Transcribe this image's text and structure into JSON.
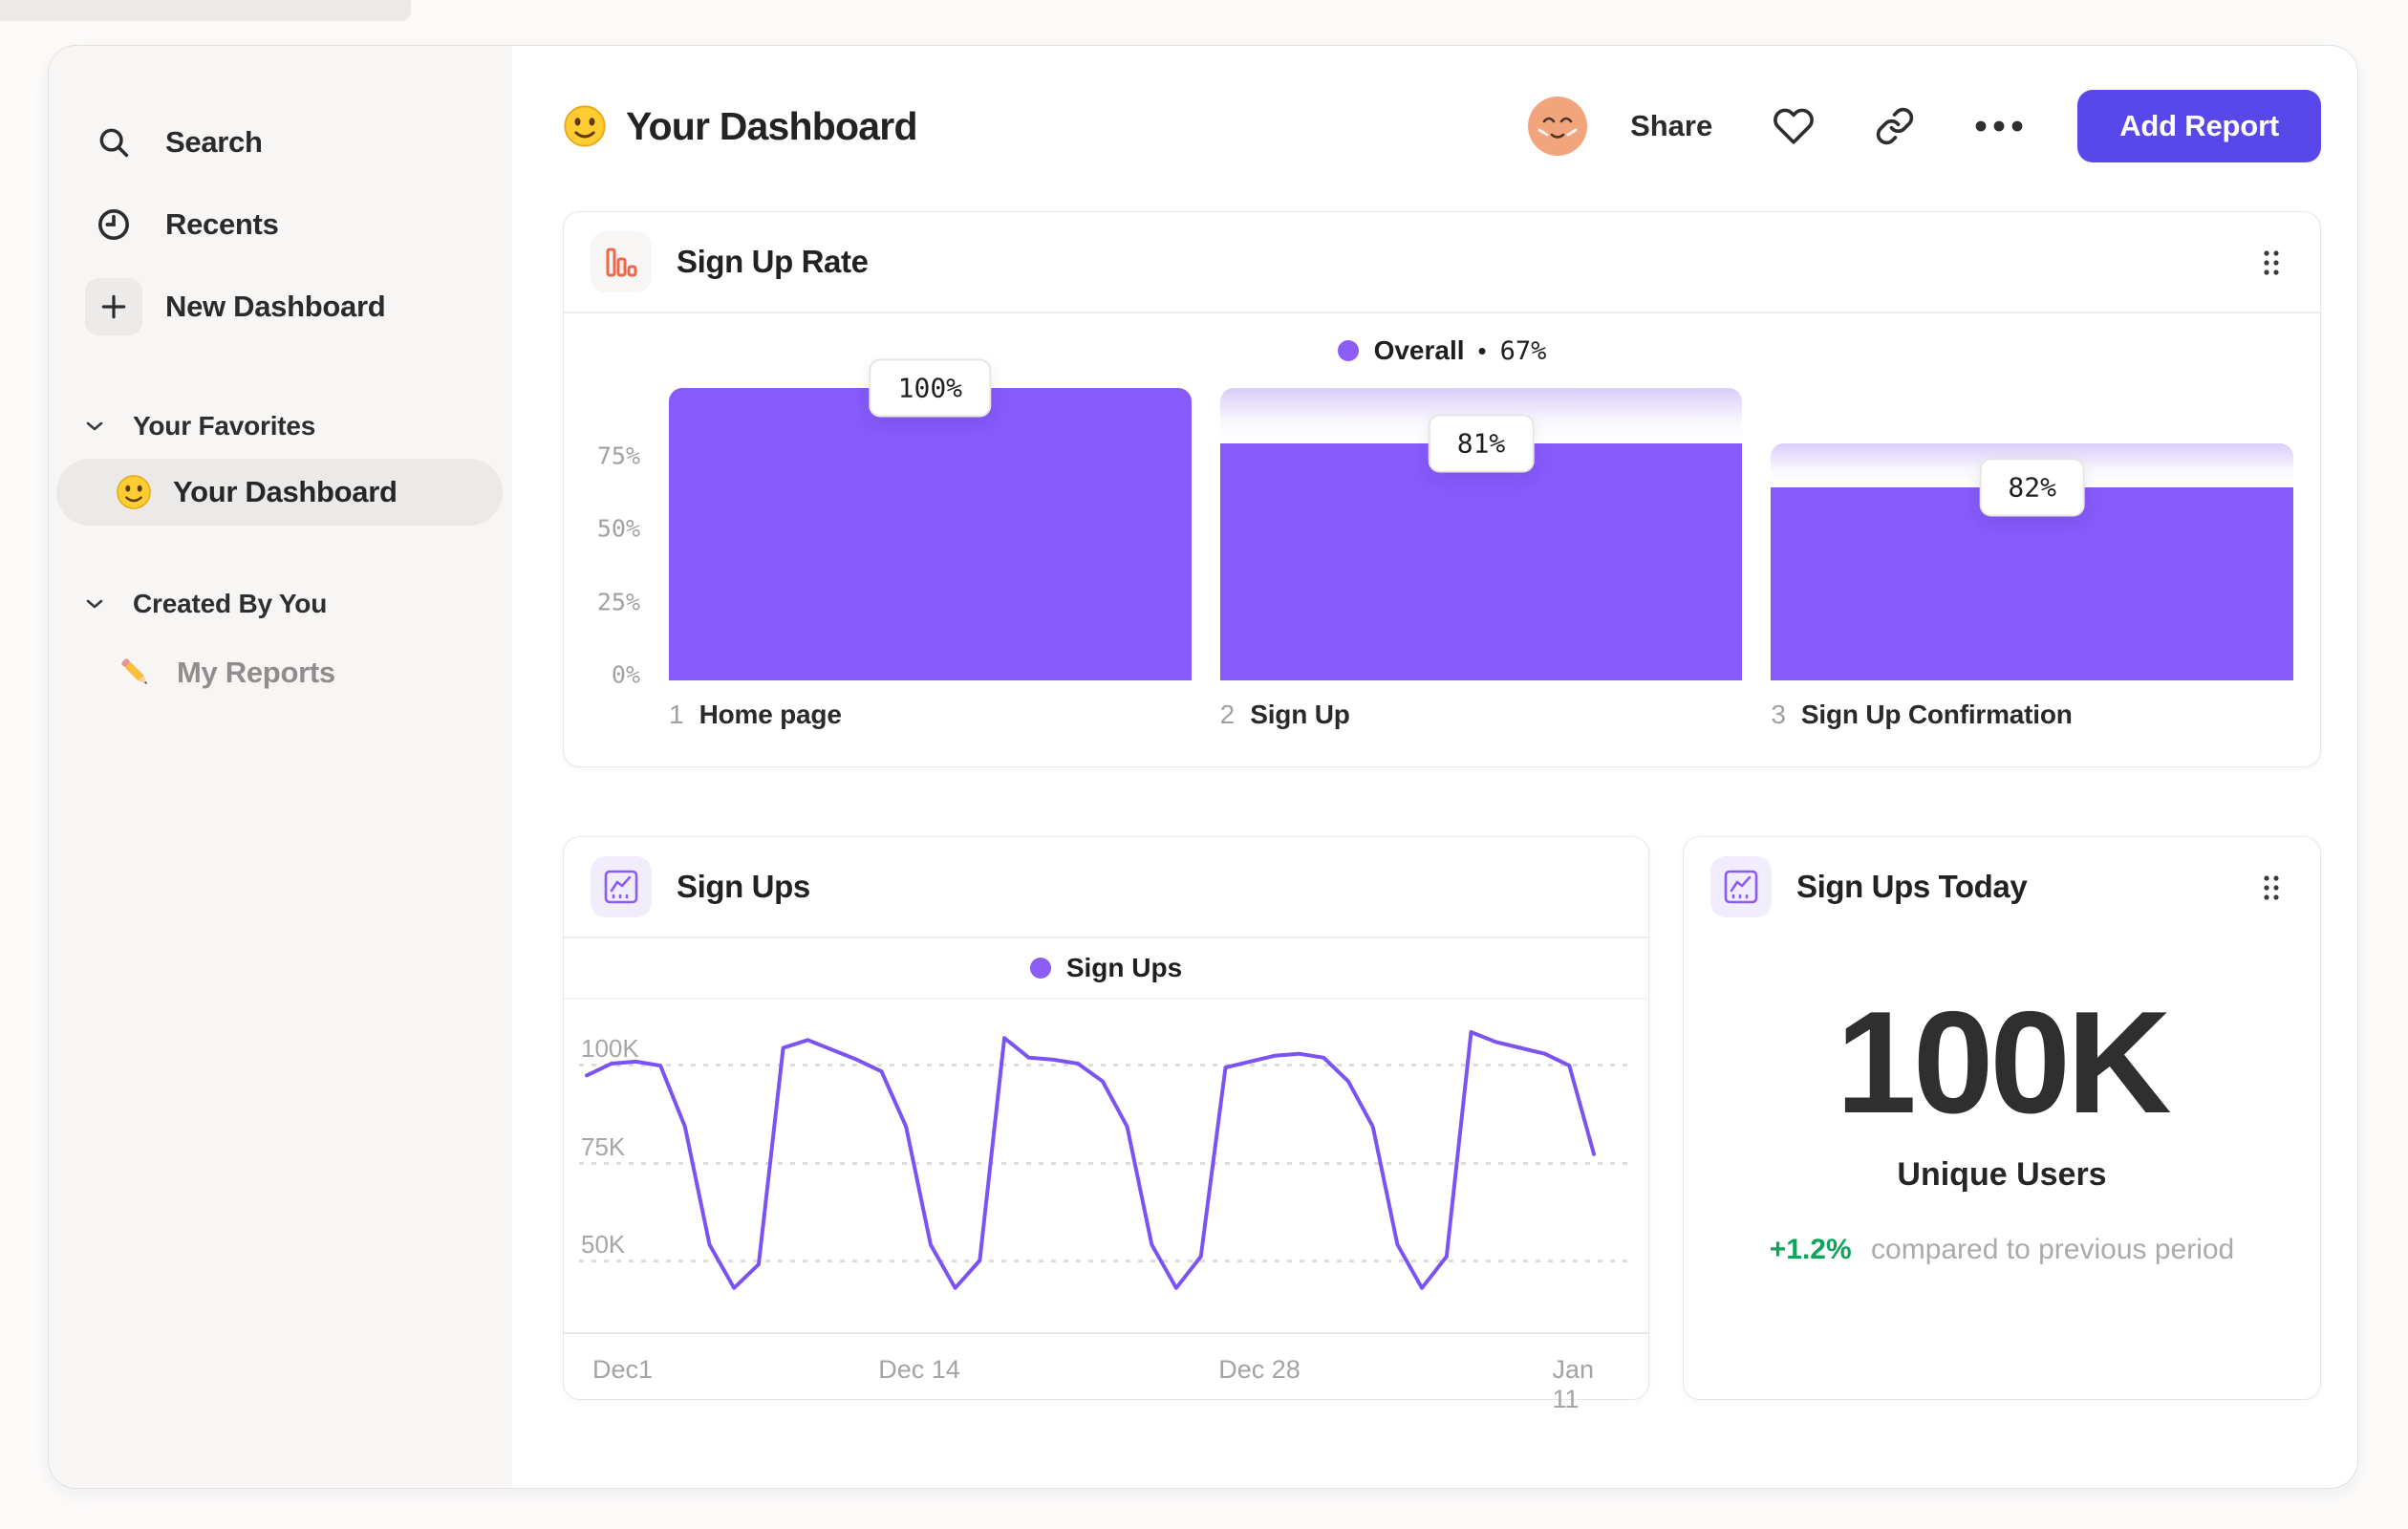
{
  "sidebar": {
    "nav": [
      {
        "icon": "search-icon",
        "label": "Search"
      },
      {
        "icon": "clock-icon",
        "label": "Recents"
      },
      {
        "icon": "plus-icon",
        "label": "New Dashboard"
      }
    ],
    "favorites": {
      "title": "Your Favorites",
      "item": {
        "emoji": "smiley",
        "label": "Your Dashboard",
        "selected": true
      }
    },
    "created": {
      "title": "Created By You",
      "item": {
        "emoji": "pencil",
        "label": "My Reports"
      }
    }
  },
  "header": {
    "emoji": "smiley",
    "title": "Your Dashboard",
    "share_label": "Share",
    "add_report_label": "Add Report"
  },
  "funnel": {
    "title": "Sign Up Rate",
    "legend": {
      "label": "Overall",
      "separator": "•",
      "value": "67%"
    },
    "y_ticks": [
      "75%",
      "50%",
      "25%",
      "0%"
    ],
    "steps": [
      {
        "num": "1",
        "label": "Home page",
        "tooltip": "100%"
      },
      {
        "num": "2",
        "label": "Sign Up",
        "tooltip": "81%"
      },
      {
        "num": "3",
        "label": "Sign Up Confirmation",
        "tooltip": "82%"
      }
    ]
  },
  "line": {
    "title": "Sign Ups",
    "legend": "Sign Ups",
    "y_ticks": [
      "100K",
      "75K",
      "50K"
    ],
    "x_ticks": [
      "Dec1",
      "Dec 14",
      "Dec 28",
      "Jan 11"
    ]
  },
  "stat": {
    "title": "Sign Ups Today",
    "value": "100K",
    "label": "Unique Users",
    "delta": "+1.2%",
    "note": "compared to previous period"
  },
  "colors": {
    "bar_purple": "#865afb",
    "ghost_purple": "#d9cdf8",
    "legend_purple": "#8b5cf6",
    "line_purple": "#7b53f2",
    "button_indigo": "#5847e9",
    "funnel_icon_orange": "#f1664b",
    "delta_green": "#0fa45a",
    "sidebar_gray": "#f7f6f5"
  },
  "chart_data": [
    {
      "type": "bar",
      "subtype": "funnel",
      "title": "Sign Up Rate",
      "categories": [
        "Home page",
        "Sign Up",
        "Sign Up Confirmation"
      ],
      "step_conversion_pct": [
        100,
        81,
        82
      ],
      "cumulative_pct": [
        100,
        81,
        66
      ],
      "overall_label": "Overall",
      "overall_pct": 67,
      "ylim": [
        0,
        100
      ],
      "yticks": [
        75,
        50,
        25,
        0
      ],
      "unit": "%"
    },
    {
      "type": "line",
      "title": "Sign Ups",
      "xlabel": "",
      "ylabel": "",
      "xticks": [
        "Dec1",
        "Dec 14",
        "Dec 28",
        "Jan 11"
      ],
      "xtick_day_index": [
        0,
        13,
        27,
        41
      ],
      "yticks_k": [
        100,
        75,
        50
      ],
      "ylim_k": [
        30,
        115
      ],
      "grid": "dashed-horizontal",
      "legend_position": "top-center",
      "series": [
        {
          "name": "Sign Ups",
          "unit": "K",
          "values": [
            97,
            100,
            100.5,
            99.5,
            84,
            54,
            43,
            49,
            104,
            106,
            103.5,
            101,
            98,
            84,
            54,
            43,
            50,
            106.5,
            101.5,
            101,
            100,
            95.5,
            84,
            54,
            43,
            51,
            99,
            100.5,
            102,
            102.5,
            101.5,
            95.5,
            84,
            54,
            43,
            51,
            108,
            105.5,
            104,
            102.5,
            99.5,
            77
          ]
        }
      ]
    }
  ]
}
